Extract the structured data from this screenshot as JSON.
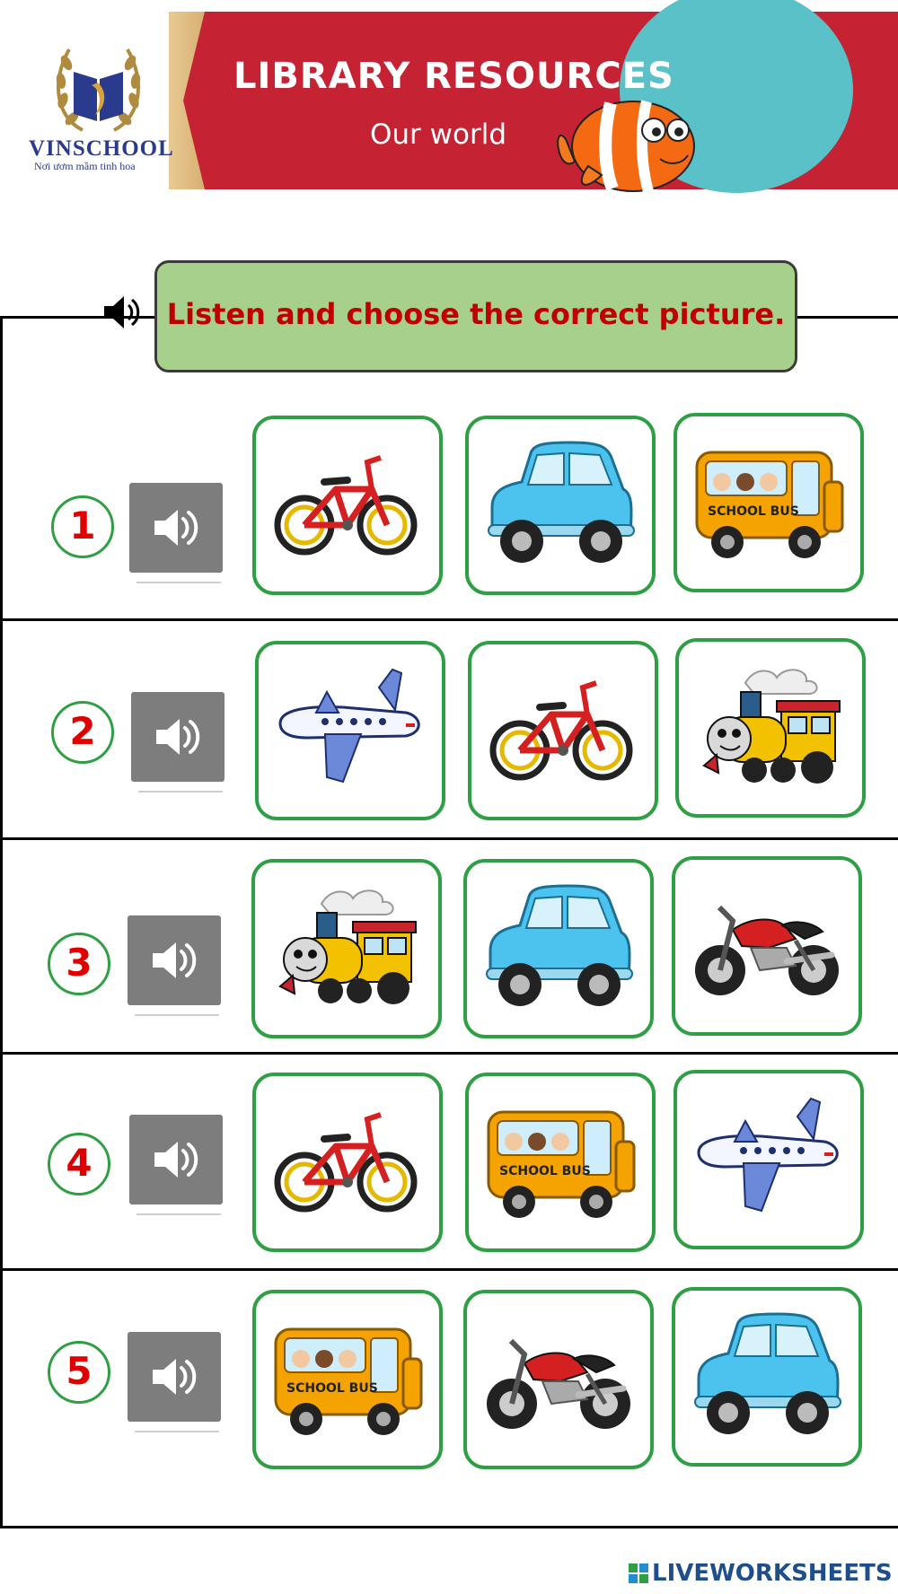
{
  "header": {
    "logo_text": "VINSCHOOL",
    "logo_tagline": "Nơi ươm mầm tinh hoa",
    "title": "LIBRARY RESOURCES",
    "subtitle": "Our world"
  },
  "instruction": {
    "text": "Listen and choose the correct picture."
  },
  "questions": [
    {
      "number": "1",
      "options": [
        "bicycle",
        "car",
        "school-bus"
      ]
    },
    {
      "number": "2",
      "options": [
        "airplane",
        "bicycle",
        "train"
      ]
    },
    {
      "number": "3",
      "options": [
        "train",
        "car",
        "motorbike"
      ]
    },
    {
      "number": "4",
      "options": [
        "bicycle",
        "school-bus",
        "airplane"
      ]
    },
    {
      "number": "5",
      "options": [
        "school-bus",
        "motorbike",
        "car"
      ]
    }
  ],
  "bus_label": "SCHOOL BUS",
  "icons": {
    "speaker": "speaker-icon",
    "logo": "vinschool-logo-icon",
    "mascot": "clownfish-icon"
  },
  "colors": {
    "banner_red": "#c52233",
    "instruction_green": "#a8d08d",
    "card_border": "#2ea043",
    "number_red": "#e00000",
    "audio_gray": "#7d7d7d"
  },
  "footer": {
    "brand": "LIVEWORKSHEETS"
  }
}
